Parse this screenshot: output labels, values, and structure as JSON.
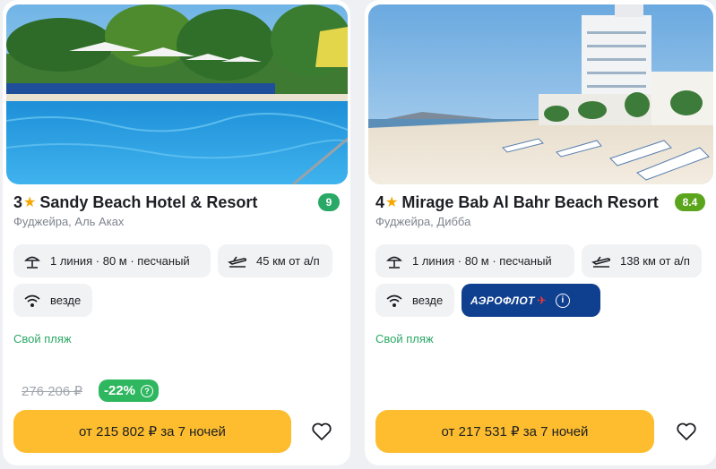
{
  "colors": {
    "accent_button": "#fdbd2e",
    "discount_green": "#2fb760",
    "beach_text": "#2aa865",
    "aeroflot_blue": "#0f3f8f"
  },
  "hotels": [
    {
      "stars": "3",
      "name": "Sandy Beach Hotel & Resort",
      "rating": "9",
      "location": "Фуджейра, Аль Аках",
      "beach_line": "1 линия · 80 м · песчаный",
      "airport": "45 км от а/п",
      "wifi": "везде",
      "beach_note": "Свой пляж",
      "old_price": "276 206 ₽",
      "discount": "-22%",
      "price_button": "от 215 802 ₽ за 7 ночей",
      "icons": [
        "star-icon",
        "beach-umbrella-icon",
        "plane-icon",
        "wifi-icon",
        "question-icon",
        "heart-icon"
      ]
    },
    {
      "stars": "4",
      "name": "Mirage Bab Al Bahr Beach Resort",
      "rating": "8.4",
      "location": "Фуджейра, Дибба",
      "beach_line": "1 линия · 80 м · песчаный",
      "airport": "138 км от а/п",
      "wifi": "везде",
      "airline": "АЭРОФЛОТ",
      "beach_note": "Свой пляж",
      "price_button": "от 217 531 ₽ за 7 ночей",
      "icons": [
        "star-icon",
        "beach-umbrella-icon",
        "plane-icon",
        "wifi-icon",
        "aeroflot-logo",
        "info-icon",
        "heart-icon"
      ]
    }
  ]
}
